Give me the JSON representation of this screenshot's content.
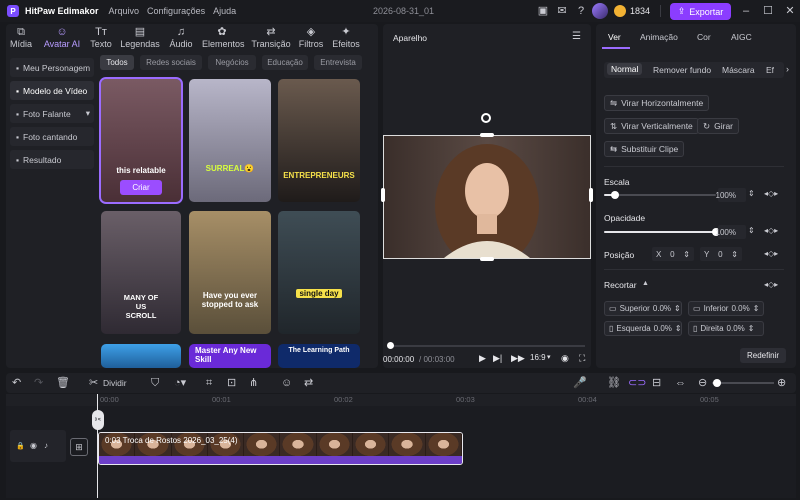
{
  "title_bar": {
    "logo_letter": "P",
    "app_name": "HitPaw Edimakor",
    "menu": [
      "Arquivo",
      "Configurações",
      "Ajuda"
    ],
    "doc_title": "2026-08-31_01",
    "credits": "1834",
    "export_label": "Exportar"
  },
  "left_panel": {
    "tabs": [
      {
        "label": "Mídia",
        "icon": "media-icon"
      },
      {
        "label": "Avatar AI",
        "icon": "avatar-icon"
      },
      {
        "label": "Texto",
        "icon": "text-icon"
      },
      {
        "label": "Legendas",
        "icon": "captions-icon"
      },
      {
        "label": "Áudio",
        "icon": "audio-icon"
      },
      {
        "label": "Elementos",
        "icon": "elements-icon"
      },
      {
        "label": "Transição",
        "icon": "transition-icon"
      },
      {
        "label": "Filtros",
        "icon": "filters-icon"
      },
      {
        "label": "Efeitos",
        "icon": "effects-icon"
      }
    ],
    "side_menu": [
      "Meu Personagem",
      "Modelo de Vídeo",
      "Foto Falante",
      "Foto cantando",
      "Resultado"
    ],
    "filters": [
      "Todos",
      "Redes sociais",
      "Negócios",
      "Educação",
      "Entrevista"
    ],
    "templates": [
      {
        "caption": "this relatable",
        "button": "Criar"
      },
      {
        "caption": "SURREAL😮"
      },
      {
        "caption": "ENTREPRENEURS"
      },
      {
        "caption": "MANY OF US SCROLL"
      },
      {
        "caption": "Have you ever stopped to ask"
      },
      {
        "caption": "single day"
      },
      {
        "caption": ""
      },
      {
        "caption": "Master Any New Skill"
      },
      {
        "caption": "The Learning Path"
      }
    ]
  },
  "preview": {
    "label": "Aparelho",
    "time_current": "00:00:00",
    "time_total": "/ 00:03:00",
    "aspect": "16:9"
  },
  "right_panel": {
    "tabs": [
      "Ver",
      "Animação",
      "Cor",
      "AIGC"
    ],
    "sub_tabs": [
      "Normal",
      "Remover fundo",
      "Máscara",
      "Ef"
    ],
    "flip_h": "Virar Horizontalmente",
    "flip_v": "Virar Verticalmente",
    "rotate": "Girar",
    "replace": "Substituir Clipe",
    "scale_label": "Escala",
    "scale_value": "100%",
    "scale_level": 0.1,
    "opacity_label": "Opacidade",
    "opacity_value": "100%",
    "opacity_level": 1.0,
    "position_label": "Posição",
    "pos_x_label": "X",
    "pos_x": "0",
    "pos_y_label": "Y",
    "pos_y": "0",
    "crop_label": "Recortar",
    "crop_top": "Superior",
    "crop_top_val": "0.0%",
    "crop_bottom": "Inferior",
    "crop_bottom_val": "0.0%",
    "crop_left": "Esquerda",
    "crop_left_val": "0.0%",
    "crop_right": "Direita",
    "crop_right_val": "0.0%",
    "reset": "Redefinir"
  },
  "toolbar": {
    "split_label": "Dividir"
  },
  "timeline": {
    "ruler": [
      "00:00",
      "00:01",
      "00:02",
      "00:03",
      "00:04",
      "00:05"
    ],
    "clip_label": "0:03 Troca de Rostos 2026_03_25(4)"
  },
  "colors": {
    "accent": "#8b3dff",
    "panel": "#1f2025",
    "background": "#18191d"
  }
}
